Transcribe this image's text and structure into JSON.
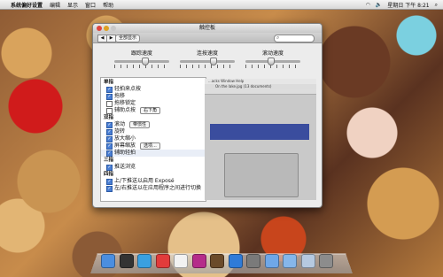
{
  "menubar": {
    "apple_glyph": "",
    "app_name": "系统偏好设置",
    "items": [
      "编辑",
      "显示",
      "窗口",
      "帮助"
    ],
    "clock": "星期日 下午 8:21"
  },
  "window": {
    "title": "触控板",
    "show_all_label": "全部显示",
    "search_placeholder": ""
  },
  "sliders": [
    {
      "label": "跟踪速度",
      "value": 0.55
    },
    {
      "label": "连按速度",
      "value": 0.6
    },
    {
      "label": "滚动速度",
      "value": 0.45
    }
  ],
  "list": {
    "sections": [
      {
        "title": "单指",
        "items": [
          {
            "label": "轻拍来点按",
            "checked": true
          },
          {
            "label": "拖移",
            "checked": true
          },
          {
            "label": "拖移锁定",
            "checked": false
          },
          {
            "label": "辅助点按",
            "checked": false,
            "popup": "右下角"
          }
        ]
      },
      {
        "title": "双指",
        "items": [
          {
            "label": "滚动",
            "checked": true,
            "popup": "带惯性"
          },
          {
            "label": "旋转",
            "checked": true
          },
          {
            "label": "放大缩小",
            "checked": true
          },
          {
            "label": "屏幕缩放",
            "checked": true,
            "popup": "选项..."
          },
          {
            "label": "辅助轻拍",
            "checked": true,
            "selected": true
          }
        ]
      },
      {
        "title": "三指",
        "items": [
          {
            "label": "推送浏览",
            "checked": true
          }
        ]
      },
      {
        "title": "四指",
        "items": [
          {
            "label": "上/下推送以启用 Exposé",
            "checked": true
          },
          {
            "label": "左/右推送以在应用程序之间进行切换",
            "checked": true
          }
        ]
      }
    ]
  },
  "preview": {
    "menu_text": "...acks   Window   Help",
    "window_title": "On the lake.jpg (13 documents)"
  },
  "dock": {
    "icons": [
      "finder-icon",
      "dashboard-icon",
      "safari-icon",
      "ical-icon",
      "calendar-icon",
      "itunes-icon",
      "photo-icon",
      "preview-icon",
      "preferences-icon",
      "folder-icon",
      "downloads-icon",
      "documents-icon",
      "trash-icon"
    ],
    "colors": [
      "#4b8ee0",
      "#333333",
      "#3aa0e0",
      "#e23b3b",
      "#f2f2f2",
      "#b52c8a",
      "#6b4b2a",
      "#2f7bd8",
      "#7a7a7a",
      "#6fa7e8",
      "#86b6ea",
      "#b6c9e0",
      "#8c8c8c"
    ]
  }
}
